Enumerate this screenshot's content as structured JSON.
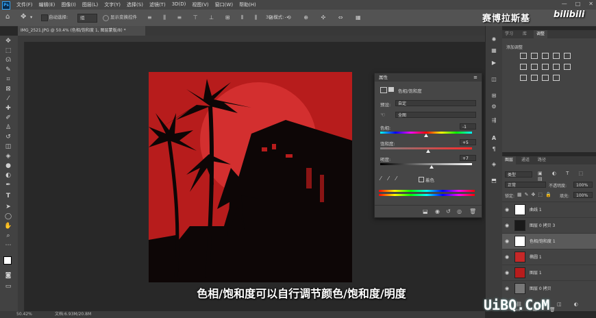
{
  "menubar": {
    "app_icon": "Ps",
    "items": [
      "文件(F)",
      "编辑(E)",
      "图像(I)",
      "图层(L)",
      "文字(Y)",
      "选择(S)",
      "滤镜(T)",
      "3D(D)",
      "视图(V)",
      "窗口(W)",
      "帮助(H)"
    ],
    "window_controls": [
      "—",
      "□",
      "✕"
    ]
  },
  "options_bar": {
    "auto_select_label": "自动选择:",
    "auto_select_value": "组",
    "show_transform_label": "显示变换控件",
    "mode_3d_label": "3D 模式:"
  },
  "document_tab": {
    "title": "IMG_2521.JPG @ 50.4% (色相/饱和度 1, 图层蒙版/8) *",
    "close": "×"
  },
  "properties_panel": {
    "title": "属性",
    "subtitle": "色相/饱和度",
    "preset_label": "预设:",
    "preset_value": "自定",
    "channel_value": "全图",
    "hue_label": "色相:",
    "hue_value": "-1",
    "hue_position": 0.5,
    "saturation_label": "饱和度:",
    "saturation_value": "+5",
    "saturation_position": 0.52,
    "lightness_label": "明度:",
    "lightness_value": "+7",
    "lightness_position": 0.56,
    "colorize_label": "着色"
  },
  "adjustments_panel": {
    "tabs": [
      "学习",
      "库",
      "调整"
    ],
    "active_tab": "调整",
    "title": "添加调整"
  },
  "layers_panel": {
    "tabs": [
      "图层",
      "通道",
      "路径"
    ],
    "filter_value": "类型",
    "blend_mode": "正常",
    "opacity_label": "不透明度:",
    "opacity_value": "100%",
    "lock_label": "锁定:",
    "fill_label": "填充:",
    "fill_value": "100%",
    "layers": [
      {
        "name": "曲线 1",
        "thumb": "#ffffff",
        "active": false
      },
      {
        "name": "图层 0 拷贝 3",
        "thumb": "#1a1a1a",
        "active": false
      },
      {
        "name": "色相/饱和度 1",
        "thumb": "#ffffff",
        "active": true
      },
      {
        "name": "椭圆 1",
        "thumb": "#c62828",
        "active": false
      },
      {
        "name": "图层 1",
        "thumb": "#b71c1c",
        "active": false
      },
      {
        "name": "图层 0 拷贝",
        "thumb": "#777777",
        "active": false
      }
    ]
  },
  "statusbar": {
    "zoom": "50.42%",
    "doc_info": "文档:6.93M/20.8M"
  },
  "overlays": {
    "caption": "色相/饱和度可以自行调节颜色/饱和度/明度",
    "brand_text": "赛博拉斯基",
    "bili_logo": "bilibili",
    "site_logo": "UiBQ.CoM"
  },
  "colors": {
    "artwork_bg": "#b71c1c",
    "sun_circle": "#d32f2f",
    "silhouette": "#0d0606"
  }
}
